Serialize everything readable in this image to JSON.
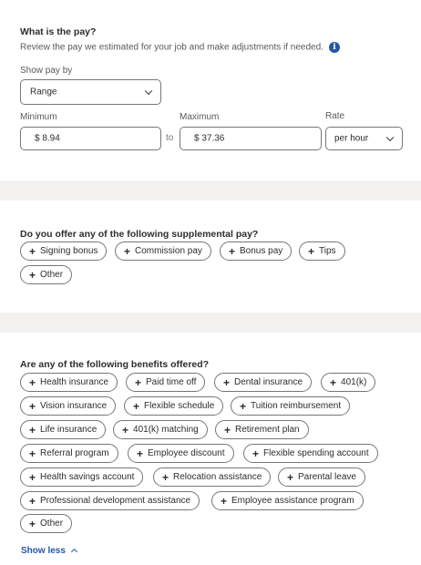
{
  "pay": {
    "title": "What is the pay?",
    "subtitle": "Review the pay we estimated for your job and make adjustments if needed.",
    "info_icon": "info-icon",
    "show_pay_by_label": "Show pay by",
    "show_pay_by_value": "Range",
    "minimum_label": "Minimum",
    "minimum_value": "$  8.94",
    "to_label": "to",
    "maximum_label": "Maximum",
    "maximum_value": "$  37.36",
    "rate_label": "Rate",
    "rate_value": "per hour"
  },
  "supplemental": {
    "title": "Do you offer any of the following supplemental pay?",
    "options": [
      "Signing bonus",
      "Commission pay",
      "Bonus pay",
      "Tips",
      "Other"
    ]
  },
  "benefits": {
    "title": "Are any of the following benefits offered?",
    "options": [
      "Health insurance",
      "Paid time off",
      "Dental insurance",
      "401(k)",
      "Vision insurance",
      "Flexible schedule",
      "Tuition reimbursement",
      "Life insurance",
      "401(k) matching",
      "Retirement plan",
      "Referral program",
      "Employee discount",
      "Flexible spending account",
      "Health savings account",
      "Relocation assistance",
      "Parental leave",
      "Professional development assistance",
      "Employee assistance program",
      "Other"
    ],
    "show_less": "Show less"
  },
  "colors": {
    "accent": "#2557a7",
    "band": "#f3f2f1",
    "border": "#767676"
  }
}
